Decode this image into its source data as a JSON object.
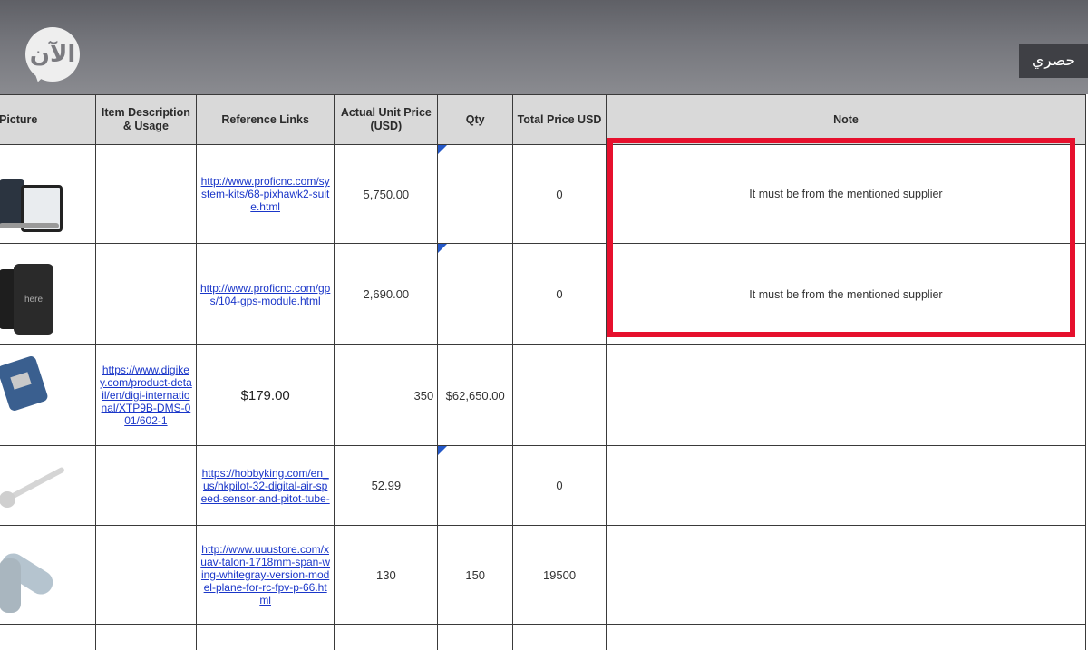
{
  "watermark": {
    "logo_text": "الآن",
    "badge": "حصري"
  },
  "table": {
    "headers": {
      "picture": "Picture",
      "item_description": "Item Description & Usage",
      "reference_links": "Reference Links",
      "unit_price": "Actual Unit Price (USD)",
      "qty": "Qty",
      "total_price": "Total Price USD",
      "note": "Note"
    },
    "rows": [
      {
        "description": "",
        "link": "http://www.proficnc.com/system-kits/68-pixhawk2-suite.html",
        "unit_price": "5,750.00",
        "qty": "",
        "total": "0",
        "note": "It must be from the mentioned supplier"
      },
      {
        "description": "",
        "link": "http://www.proficnc.com/gps/104-gps-module.html",
        "unit_price": "2,690.00",
        "qty": "",
        "total": "0",
        "note": "It must be from the mentioned supplier"
      },
      {
        "description": "https://www.digikey.com/product-detail/en/digi-international/XTP9B-DMS-001/602-1",
        "link": "$179.00",
        "unit_price": "350",
        "qty": "$62,650.00",
        "total": "",
        "note": ""
      },
      {
        "description": "",
        "link": "https://hobbyking.com/en_us/hkpilot-32-digital-air-speed-sensor-and-pitot-tube-",
        "unit_price": "52.99",
        "qty": "",
        "total": "0",
        "note": ""
      },
      {
        "description": "",
        "link": "http://www.uuustore.com/xuav-talon-1718mm-span-wing-whitegray-version-model-plane-for-rc-fpv-p-66.html",
        "unit_price": "130",
        "qty": "150",
        "total": "19500",
        "note": ""
      }
    ]
  }
}
